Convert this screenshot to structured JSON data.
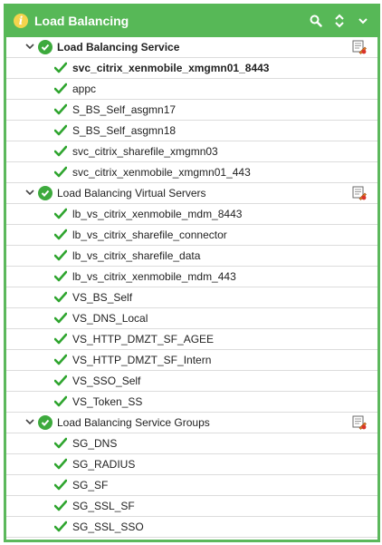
{
  "header": {
    "title": "Load Balancing",
    "info_icon": "info-icon",
    "icons": [
      "search-icon",
      "collapse-expand-icon",
      "chevron-down-icon"
    ]
  },
  "colors": {
    "header_bg": "#57b857",
    "border": "#5cb85c",
    "check": "#2fa52f"
  },
  "groups": [
    {
      "label": "Load Balancing Service",
      "items": [
        "svc_citrix_xenmobile_xmgmn01_8443",
        "appc",
        "S_BS_Self_asgmn17",
        "S_BS_Self_asgmn18",
        "svc_citrix_sharefile_xmgmn03",
        "svc_citrix_xenmobile_xmgmn01_443"
      ]
    },
    {
      "label": "Load Balancing Virtual Servers",
      "items": [
        "lb_vs_citrix_xenmobile_mdm_8443",
        "lb_vs_citrix_sharefile_connector",
        "lb_vs_citrix_sharefile_data",
        "lb_vs_citrix_xenmobile_mdm_443",
        "VS_BS_Self",
        "VS_DNS_Local",
        "VS_HTTP_DMZT_SF_AGEE",
        "VS_HTTP_DMZT_SF_Intern",
        "VS_SSO_Self",
        "VS_Token_SS"
      ]
    },
    {
      "label": "Load Balancing Service Groups",
      "items": [
        "SG_DNS",
        "SG_RADIUS",
        "SG_SF",
        "SG_SSL_SF",
        "SG_SSL_SSO"
      ]
    }
  ]
}
